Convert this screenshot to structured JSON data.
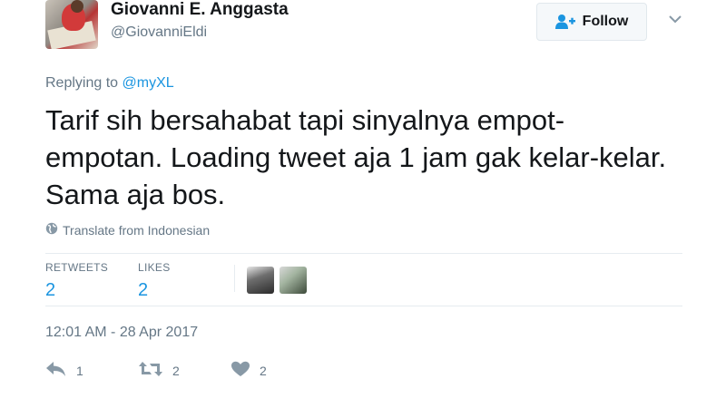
{
  "tweet": {
    "author_name": "Giovanni E. Anggasta",
    "author_handle": "@GiovanniEldi",
    "follow_label": "Follow",
    "replying_prefix": "Replying to",
    "replying_to": "@myXL",
    "text": "Tarif sih bersahabat tapi sinyalnya empot-empotan. Loading tweet aja 1 jam gak kelar-kelar. Sama aja bos.",
    "translate_label": "Translate from Indonesian",
    "stats": {
      "retweets_label": "RETWEETS",
      "retweets_value": "2",
      "likes_label": "LIKES",
      "likes_value": "2"
    },
    "timestamp": "12:01 AM - 28 Apr 2017",
    "actions": {
      "reply_count": "1",
      "retweet_count": "2",
      "like_count": "2"
    }
  },
  "colors": {
    "accent": "#1b95e0",
    "secondary_text": "#657786",
    "primary_text": "#14171a",
    "divider": "#e6ecf0"
  },
  "icons": [
    "user-add-icon",
    "chevron-down-icon",
    "globe-icon",
    "reply-icon",
    "retweet-icon",
    "heart-icon"
  ]
}
